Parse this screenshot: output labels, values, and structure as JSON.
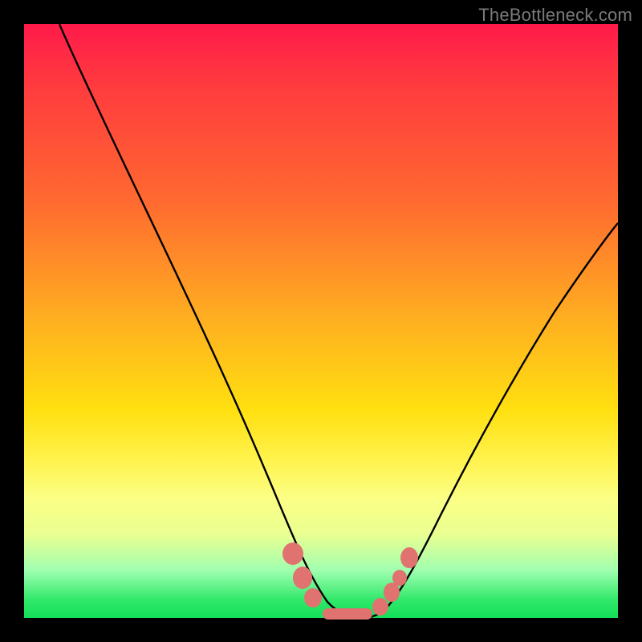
{
  "watermark": "TheBottleneck.com",
  "chart_data": {
    "type": "line",
    "title": "",
    "xlabel": "",
    "ylabel": "",
    "xlim": [
      0,
      100
    ],
    "ylim": [
      0,
      100
    ],
    "grid": false,
    "legend": false,
    "background_gradient": {
      "top": "#ff1a4a",
      "mid_upper": "#ff6a30",
      "mid": "#ffe010",
      "mid_lower": "#fbff86",
      "bottom": "#14df58"
    },
    "series": [
      {
        "name": "bottleneck-curve",
        "color": "#000000",
        "x": [
          6,
          10,
          15,
          20,
          25,
          30,
          35,
          38,
          40,
          43,
          46,
          50,
          55,
          58,
          60,
          62,
          65,
          70,
          75,
          80,
          85,
          90,
          95,
          100
        ],
        "y": [
          100,
          90,
          78,
          66,
          54,
          42,
          30,
          22,
          16,
          10,
          5,
          1,
          0,
          0,
          1,
          3,
          7,
          15,
          24,
          33,
          42,
          50,
          57,
          63
        ]
      },
      {
        "name": "highlight-markers",
        "color": "#e0736f",
        "type": "scatter",
        "x": [
          43,
          44.5,
          46,
          50,
          55,
          58,
          60,
          61.5,
          63
        ],
        "y": [
          9,
          6,
          4,
          1,
          0,
          0,
          1,
          3,
          6
        ]
      }
    ],
    "notes": "V-shaped curve reaching minimum (~0) near x≈55; background is a vertical rainbow heat gradient; small salmon-colored rounded markers along the valley; outer black frame; axes not labeled."
  }
}
